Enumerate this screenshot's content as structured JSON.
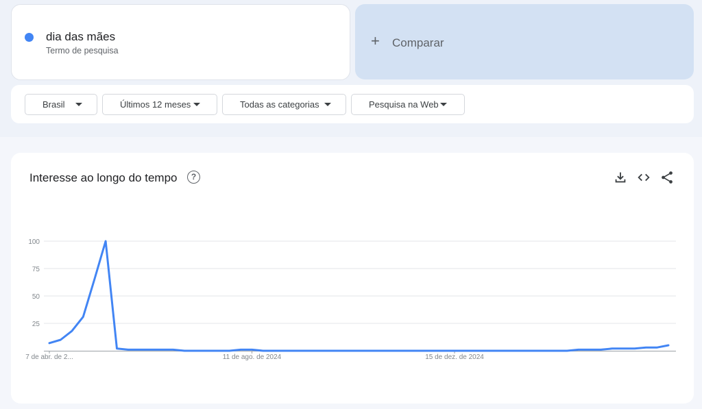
{
  "search_term": {
    "name": "dia das mães",
    "subtitle": "Termo de pesquisa",
    "color": "#4285f4"
  },
  "compare": {
    "icon": "plus-icon",
    "label": "Comparar"
  },
  "filters": [
    {
      "label": "Brasil"
    },
    {
      "label": "Últimos 12 meses"
    },
    {
      "label": "Todas as categorias"
    },
    {
      "label": "Pesquisa na Web"
    }
  ],
  "chart_section": {
    "title": "Interesse ao longo do tempo",
    "help_icon": "help-circle-icon",
    "help_glyph": "?",
    "tools": [
      "download-icon",
      "embed-code-icon",
      "share-icon"
    ]
  },
  "chart_data": {
    "type": "line",
    "title": "",
    "xlabel": "",
    "ylabel": "",
    "ylim": [
      0,
      100
    ],
    "yticks": [
      25,
      50,
      75,
      100
    ],
    "grid": true,
    "x_tick_labels": [
      "7 de abr. de 2...",
      "11 de ago. de 2024",
      "15 de dez. de 2024"
    ],
    "x_tick_index": [
      0,
      18,
      36
    ],
    "series": [
      {
        "color": "#4285f4",
        "values": [
          7,
          10,
          18,
          31,
          65,
          100,
          2,
          1,
          1,
          1,
          1,
          1,
          0,
          0,
          0,
          0,
          0,
          1,
          1,
          0,
          0,
          0,
          0,
          0,
          0,
          0,
          0,
          0,
          0,
          0,
          0,
          0,
          0,
          0,
          0,
          0,
          0,
          0,
          0,
          0,
          0,
          0,
          0,
          0,
          0,
          0,
          0,
          1,
          1,
          1,
          2,
          2,
          2,
          3,
          3,
          5
        ]
      }
    ]
  }
}
